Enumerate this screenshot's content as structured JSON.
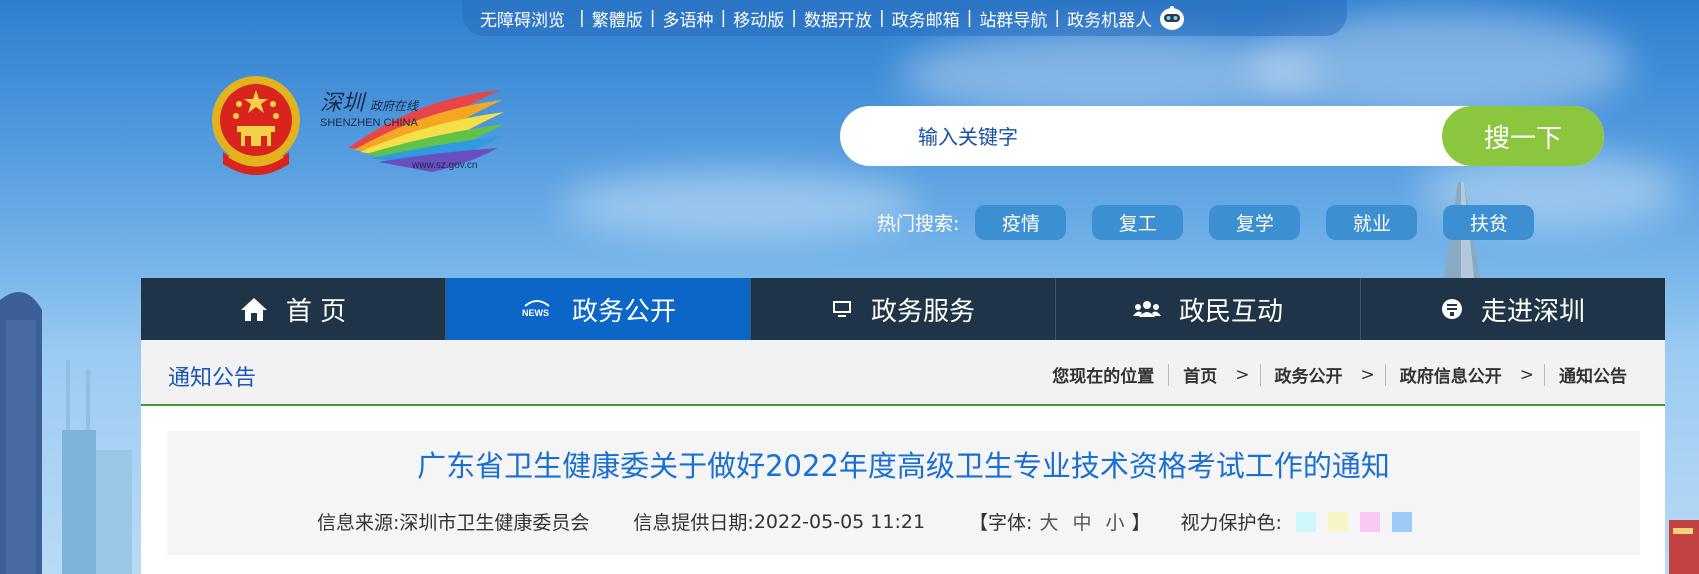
{
  "topbar": {
    "links": [
      "无障碍浏览",
      "繁體版",
      "多语种",
      "移动版",
      "数据开放",
      "政务邮箱",
      "站群导航",
      "政务机器人"
    ]
  },
  "logo": {
    "cn_name": "深圳",
    "subtitle": "政府在线",
    "en_name": "SHENZHEN CHINA",
    "url": "www.sz.gov.cn"
  },
  "search": {
    "placeholder": "输入关键字",
    "button_label": "搜一下"
  },
  "hot_search": {
    "label": "热门搜索:",
    "tags": [
      "疫情",
      "复工",
      "复学",
      "就业",
      "扶贫"
    ]
  },
  "nav": {
    "items": [
      {
        "label": "首 页",
        "icon": "home-icon"
      },
      {
        "label": "政务公开",
        "icon": "news-icon",
        "active": true
      },
      {
        "label": "政务服务",
        "icon": "monitor-icon"
      },
      {
        "label": "政民互动",
        "icon": "users-icon"
      },
      {
        "label": "走进深圳",
        "icon": "info-icon"
      }
    ]
  },
  "section": {
    "title": "通知公告"
  },
  "breadcrumb": {
    "lead": "您现在的位置",
    "items": [
      "首页",
      "政务公开",
      "政府信息公开",
      "通知公告"
    ]
  },
  "article": {
    "title": "广东省卫生健康委关于做好2022年度高级卫生专业技术资格考试工作的通知",
    "source_label": "信息来源:",
    "source": "深圳市卫生健康委员会",
    "date_label": "信息提供日期:",
    "date": "2022-05-05 11:21",
    "font_open": "【字体:",
    "font_sizes": [
      "大",
      "中",
      "小"
    ],
    "font_close": "】",
    "eye_label": "视力保护色:",
    "eye_colors": [
      "#ccf7fb",
      "#f6f5c6",
      "#fbc8f3",
      "#9ccbf7"
    ]
  },
  "colors": {
    "nav_bg": "#1f3547",
    "nav_active": "#0b66c8",
    "search_button": "#8cc63f",
    "link_blue": "#1a55b8"
  }
}
